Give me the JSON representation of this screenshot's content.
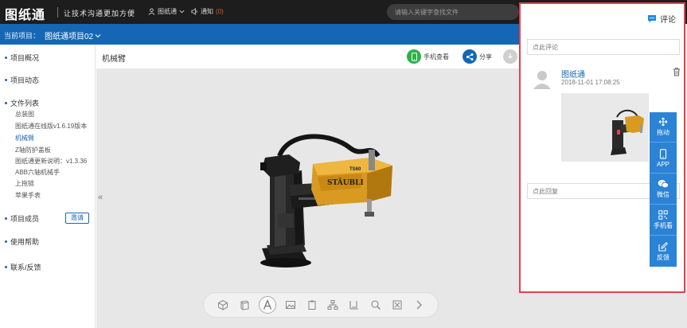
{
  "topnav": {
    "logo": "图纸通",
    "slogan": "让技术沟通更加方便",
    "user_label": "图纸通",
    "notice_label": "通知",
    "notice_count": "(0)",
    "search_placeholder": "请输入关键字查找文件"
  },
  "project_bar": {
    "label": "当前项目：",
    "value": "图纸通项目02"
  },
  "sidebar": {
    "overview": "项目概况",
    "activity": "项目动态",
    "file_list": "文件列表",
    "files": [
      "总装图",
      "图纸通在线版v1.6.19版本",
      "机械臂",
      "Z轴防护盖板",
      "图纸通更新说明：v1.3.36",
      "ABB六轴机械手",
      "上拖链",
      "苹果手表"
    ],
    "active_file_index": 2,
    "members": "项目成员",
    "invite": "邀请",
    "help": "使用帮助",
    "contact": "联系/反馈"
  },
  "viewer": {
    "title": "机械臂",
    "phone_view": "手机查看",
    "share": "分享",
    "colors": {
      "phone": "#2bb24c",
      "share": "#1567b4",
      "download": "#cfcfcf"
    },
    "model_label": "TS60",
    "brand_label": "STÄUBLI"
  },
  "comments": {
    "header": "评论",
    "input_placeholder": "点此评论",
    "items": [
      {
        "author": "图纸通",
        "time": "2018-11-01 17:08:25"
      }
    ],
    "reply_placeholder": "点此回复"
  },
  "floatbar": {
    "items": [
      {
        "label": "拖动",
        "icon": "move-icon"
      },
      {
        "label": "APP",
        "icon": "phone-icon"
      },
      {
        "label": "微信",
        "icon": "wechat-icon"
      },
      {
        "label": "手机看",
        "icon": "qrcode-icon"
      },
      {
        "label": "反馈",
        "icon": "edit-icon"
      }
    ]
  },
  "colors": {
    "brand_blue": "#1567b4",
    "highlight_border": "#e0434f",
    "robot_yellow": "#d99a22"
  }
}
